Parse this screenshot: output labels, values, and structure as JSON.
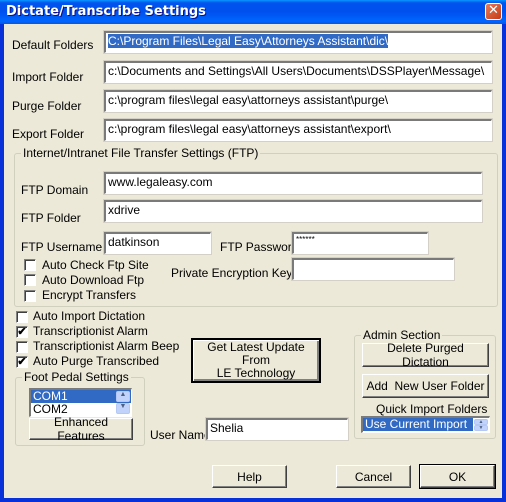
{
  "window": {
    "title": "Dictate/Transcribe Settings",
    "close_glyph": "✕"
  },
  "folders": {
    "default": {
      "label": "Default Folders",
      "value": "C:\\Program Files\\Legal Easy\\Attorneys Assistant\\dic\\"
    },
    "import": {
      "label": "Import Folder",
      "value": "c:\\Documents and Settings\\All Users\\Documents\\DSSPlayer\\Message\\"
    },
    "purge": {
      "label": "Purge Folder",
      "value": "c:\\program files\\legal easy\\attorneys assistant\\purge\\"
    },
    "export": {
      "label": "Export Folder",
      "value": "c:\\program files\\legal easy\\attorneys assistant\\export\\"
    }
  },
  "ftp": {
    "group_title": "Internet/Intranet File Transfer Settings (FTP)",
    "domain": {
      "label": "FTP Domain",
      "value": "www.legaleasy.com"
    },
    "folder": {
      "label": "FTP Folder",
      "value": "xdrive"
    },
    "username": {
      "label": "FTP Username",
      "value": "datkinson"
    },
    "password": {
      "label": "FTP Password",
      "value": "******"
    },
    "encryption_key": {
      "label": "Private Encryption Key",
      "value": ""
    },
    "checkboxes": [
      {
        "label": "Auto Check Ftp Site",
        "checked": false
      },
      {
        "label": "Auto Download Ftp",
        "checked": false
      },
      {
        "label": "Encrypt Transfers",
        "checked": false
      }
    ]
  },
  "options": [
    {
      "label": "Auto Import Dictation",
      "checked": false
    },
    {
      "label": "Transcriptionist Alarm",
      "checked": true
    },
    {
      "label": "Transcriptionist Alarm Beep",
      "checked": false
    },
    {
      "label": "Auto Purge Transcribed",
      "checked": true
    }
  ],
  "check_glyph": "✔",
  "foot_pedal": {
    "group_title": "Foot Pedal Settings",
    "ports": [
      "COM1",
      "COM2"
    ],
    "selected": "COM1",
    "enhanced_label": "Enhanced Features"
  },
  "update_button": {
    "line1": "Get Latest Update From",
    "line2": "LE Technology"
  },
  "user_name": {
    "label": "User Name",
    "value": "Shelia"
  },
  "admin": {
    "group_title": "Admin Section",
    "delete_purged_label": "Delete Purged Dictation",
    "add_user_folder_label": "Add  New User Folder",
    "quick_import_label": "Quick Import Folders",
    "quick_import_selected": "Use Current Import"
  },
  "footer": {
    "help_label": "Help",
    "cancel_label": "Cancel",
    "ok_label": "OK"
  }
}
